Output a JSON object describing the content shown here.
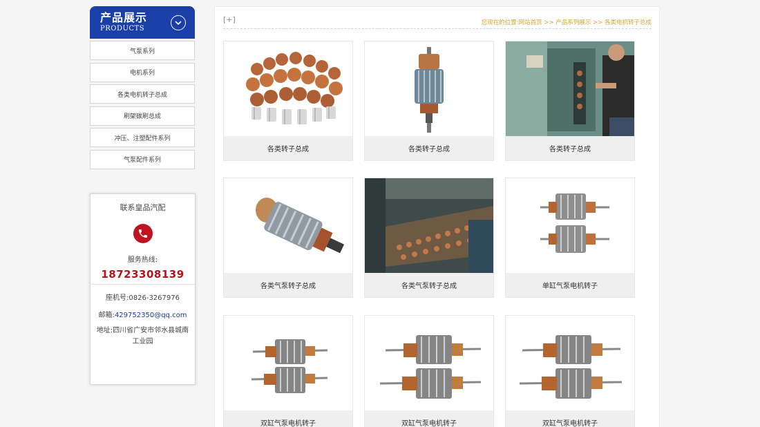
{
  "sidebar": {
    "category_title": "产品展示",
    "category_subtitle": "PRODUCTS",
    "items": [
      {
        "label": "气泵系列"
      },
      {
        "label": "电机系列"
      },
      {
        "label": "各类电机转子总成"
      },
      {
        "label": "刷架碳刷总成"
      },
      {
        "label": "冲压、注塑配件系列"
      },
      {
        "label": "气泵配件系列"
      }
    ]
  },
  "contact": {
    "title": "联系皇品汽配",
    "hotline_label": "服务热线:",
    "hotline": "18723308139",
    "landline_label": "座机号:",
    "landline": "0826-3267976",
    "email_label": "邮箱:",
    "email": "429752350@qq.com",
    "address_label": "地址:",
    "address": "四川省广安市邻水县城南工业园"
  },
  "main": {
    "expand_label": "[+]",
    "breadcrumb": {
      "prefix": "您现在的位置:",
      "home": "网站首页",
      "sep1": " >> ",
      "section": "产品系列展示",
      "sep2": " >> ",
      "current": "各类电机转子总成"
    },
    "products": [
      {
        "caption": "各类转子总成"
      },
      {
        "caption": "各类转子总成"
      },
      {
        "caption": "各类转子总成"
      },
      {
        "caption": "各类气泵转子总成"
      },
      {
        "caption": "各类气泵转子总成"
      },
      {
        "caption": "单缸气泵电机转子"
      },
      {
        "caption": "双缸气泵电机转子"
      },
      {
        "caption": "双缸气泵电机转子"
      },
      {
        "caption": "双缸气泵电机转子"
      }
    ]
  },
  "colors": {
    "brand_blue": "#1b3fa8",
    "hotline_red": "#b4141c",
    "breadcrumb_gold": "#d4a534"
  },
  "icons": {
    "toggle": "chevron-down-icon",
    "phone": "phone-icon"
  }
}
